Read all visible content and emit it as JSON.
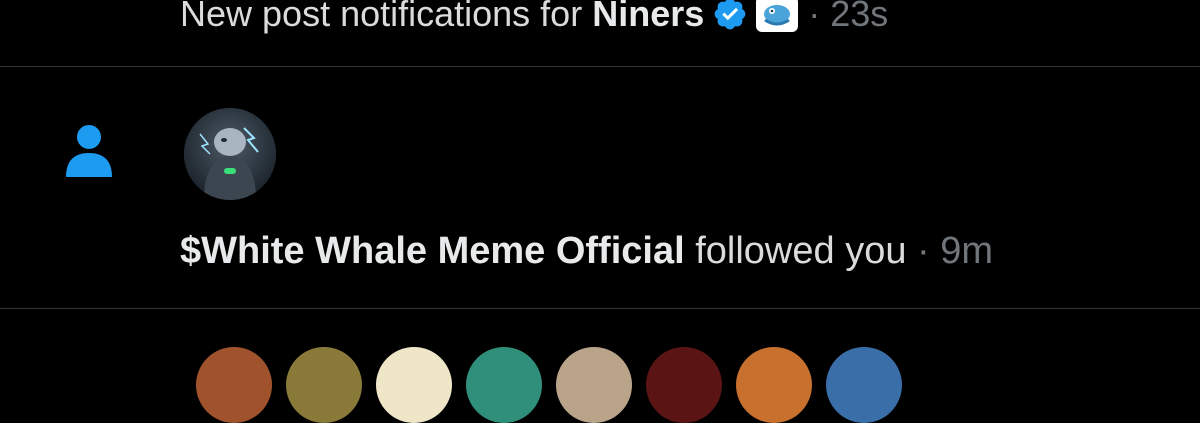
{
  "top_notification": {
    "prefix": "New post notifications for ",
    "account": "Niners",
    "separator": " · ",
    "time": "23s",
    "verified_icon": "verified-badge-icon",
    "affiliate_icon": "affiliate-badge-icon"
  },
  "follow_notification": {
    "type_icon": "person-icon",
    "account": "$White Whale Meme Official",
    "action": " followed you",
    "separator": " · ",
    "time": "9m",
    "avatar": "avatar"
  },
  "colors": {
    "background": "#000000",
    "accent": "#1d9bf0",
    "text": "#e7e9ea",
    "muted": "#71767b",
    "divider": "#2f3336"
  },
  "bottom_avatars": [
    {
      "color": "#a0522d"
    },
    {
      "color": "#8a7a3a"
    },
    {
      "color": "#efe6c8"
    },
    {
      "color": "#2f8f7a"
    },
    {
      "color": "#b9a48a"
    },
    {
      "color": "#5a1414"
    },
    {
      "color": "#c8702e"
    },
    {
      "color": "#3a6ea8"
    }
  ]
}
